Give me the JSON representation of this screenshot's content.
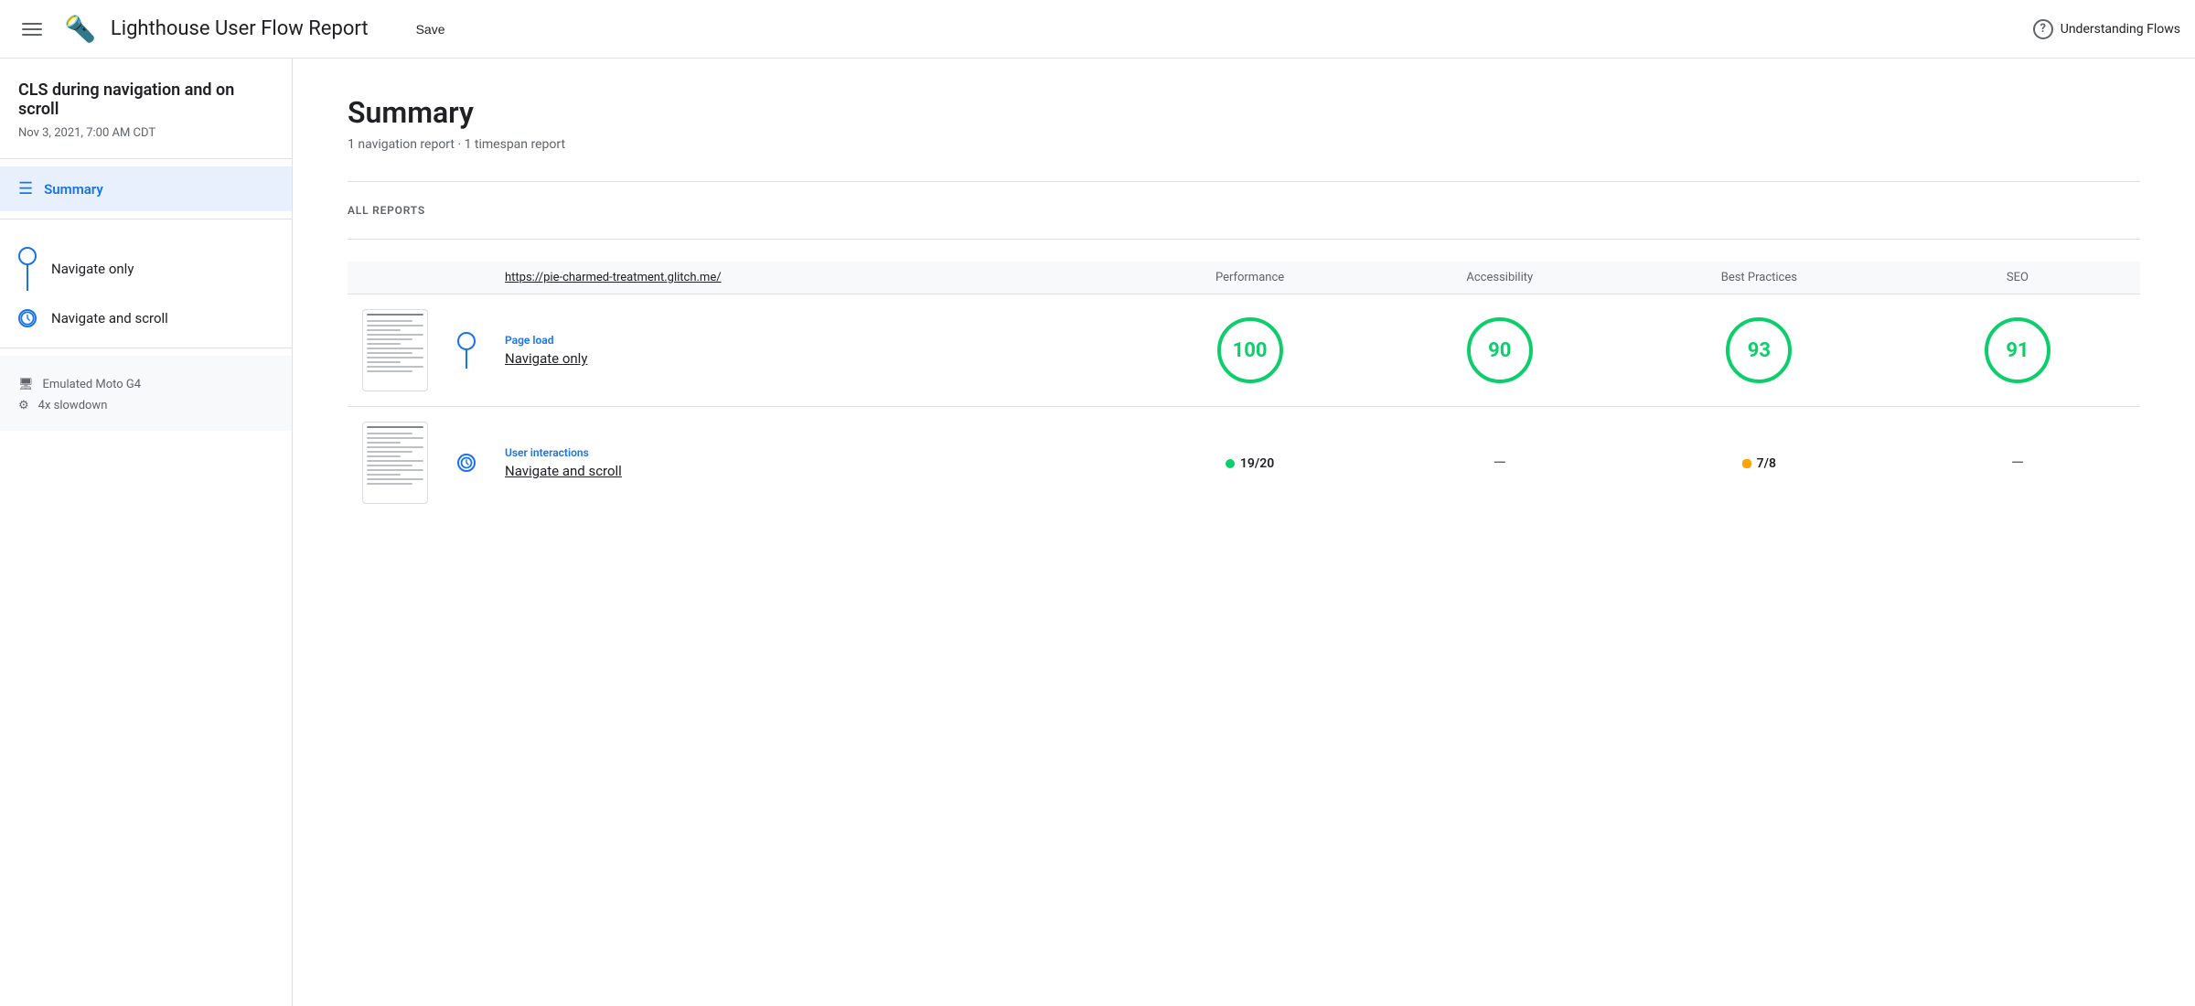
{
  "header": {
    "title": "Lighthouse User Flow Report",
    "save_label": "Save",
    "understanding_flows_label": "Understanding Flows"
  },
  "sidebar": {
    "project_title": "CLS during navigation and on scroll",
    "date": "Nov 3, 2021, 7:00 AM CDT",
    "summary_label": "Summary",
    "flow_items": [
      {
        "label": "Navigate only",
        "type": "circle"
      },
      {
        "label": "Navigate and scroll",
        "type": "clock"
      }
    ],
    "device_rows": [
      {
        "label": "Emulated Moto G4",
        "icon": "device-icon"
      },
      {
        "label": "4x slowdown",
        "icon": "cpu-icon"
      }
    ]
  },
  "content": {
    "summary_heading": "Summary",
    "summary_sub": "1 navigation report · 1 timespan report",
    "all_reports_label": "ALL REPORTS",
    "table": {
      "url_header": "https://pie-charmed-treatment.glitch.me/",
      "col_headers": [
        "Performance",
        "Accessibility",
        "Best Practices",
        "SEO"
      ],
      "rows": [
        {
          "type_label": "Page load",
          "name": "Navigate only",
          "scores": [
            {
              "type": "circle",
              "value": "100",
              "color": "green"
            },
            {
              "type": "circle",
              "value": "90",
              "color": "green"
            },
            {
              "type": "circle",
              "value": "93",
              "color": "green"
            },
            {
              "type": "circle",
              "value": "91",
              "color": "green"
            }
          ]
        },
        {
          "type_label": "User interactions",
          "name": "Navigate and scroll",
          "scores": [
            {
              "type": "badge",
              "value": "19/20",
              "dot": "green"
            },
            {
              "type": "dash"
            },
            {
              "type": "badge",
              "value": "7/8",
              "dot": "orange"
            },
            {
              "type": "dash"
            }
          ]
        }
      ]
    }
  }
}
